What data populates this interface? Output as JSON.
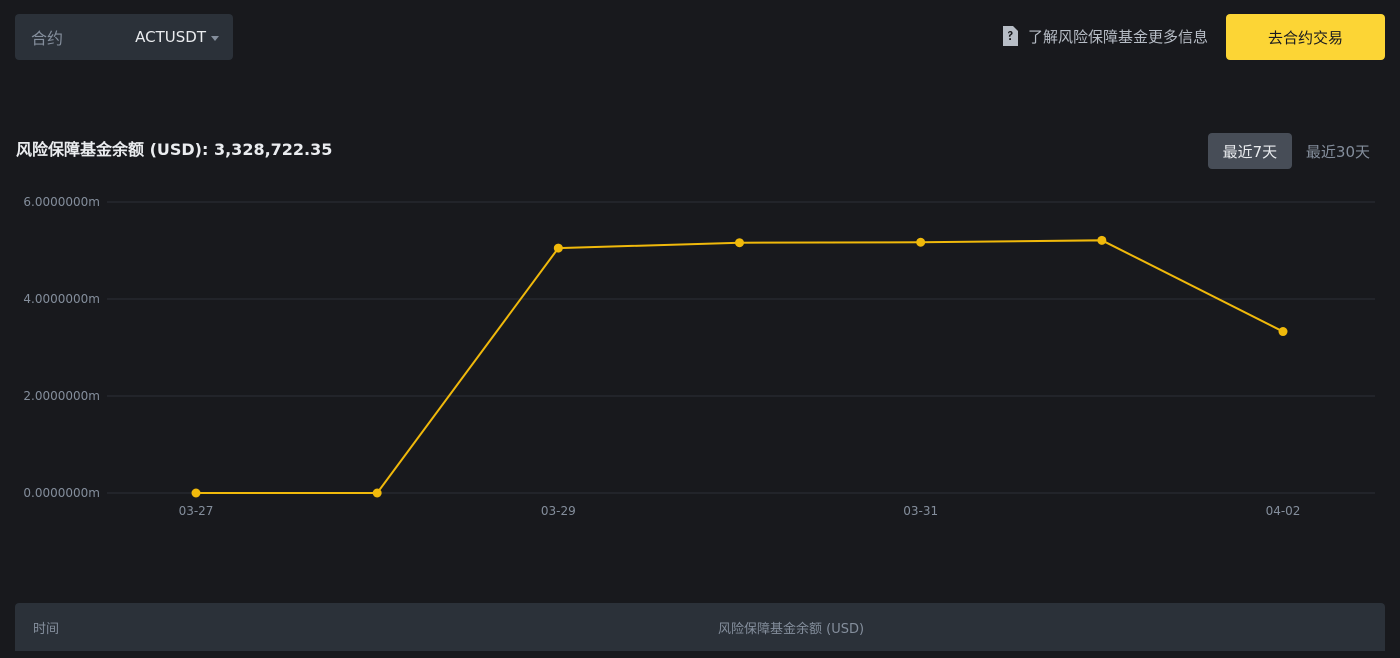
{
  "selector": {
    "label": "合约",
    "value": "ACTUSDT",
    "caret_icon": "caret-down-icon"
  },
  "info_link": {
    "icon": "question-document-icon",
    "text": "了解风险保障基金更多信息"
  },
  "trade_button": {
    "label": "去合约交易"
  },
  "balance": {
    "label": "风险保障基金余额 (USD): ",
    "value": "3,328,722.35"
  },
  "range_tabs": [
    {
      "label": "最近7天",
      "active": true
    },
    {
      "label": "最近30天",
      "active": false
    }
  ],
  "colors": {
    "accent": "#fcd535",
    "line": "#f0b90b",
    "background": "#18191d",
    "panel": "#2b3139"
  },
  "chart_data": {
    "type": "line",
    "x": [
      "03-27",
      "03-28",
      "03-29",
      "03-30",
      "03-31",
      "04-01",
      "04-02"
    ],
    "x_tick_labels": [
      "03-27",
      "03-29",
      "03-31",
      "04-02"
    ],
    "series": [
      {
        "values": [
          0,
          0,
          5050000,
          5160000,
          5170000,
          5210000,
          3328722.35
        ]
      }
    ],
    "y_ticks": [
      0,
      2000000,
      4000000,
      6000000
    ],
    "y_tick_labels": [
      "0.0000000m",
      "2.0000000m",
      "4.0000000m",
      "6.0000000m"
    ],
    "ylim": [
      0,
      6000000
    ],
    "grid": true,
    "legend": "none"
  },
  "table": {
    "headers": [
      "时间",
      "风险保障基金余额 (USD)"
    ]
  }
}
